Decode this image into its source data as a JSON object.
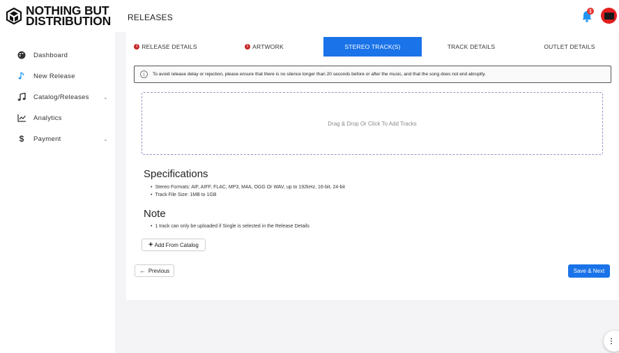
{
  "brand": {
    "line1": "NOTHING BUT",
    "line2": "DISTRIBUTION"
  },
  "header": {
    "title": "RELEASES",
    "notification_count": "1"
  },
  "sidebar": {
    "items": [
      {
        "label": "Dashboard",
        "icon": "palette-icon"
      },
      {
        "label": "New Release",
        "icon": "music-note-icon"
      },
      {
        "label": "Catalog/Releases",
        "icon": "music-notes-icon",
        "has_submenu": true
      },
      {
        "label": "Analytics",
        "icon": "chart-line-icon"
      },
      {
        "label": "Payment",
        "icon": "dollar-icon",
        "has_submenu": true
      }
    ]
  },
  "tabs": [
    {
      "label": "RELEASE DETAILS",
      "warning": true,
      "active": false
    },
    {
      "label": "ARTWORK",
      "warning": true,
      "active": false
    },
    {
      "label": "STEREO TRACK(S)",
      "warning": false,
      "active": true
    },
    {
      "label": "TRACK DETAILS",
      "warning": false,
      "active": false
    },
    {
      "label": "OUTLET DETAILS",
      "warning": false,
      "active": false
    }
  ],
  "notice": {
    "text": "To avoid release delay or rejection, please ensure that there is no silence longer than 20 seconds before or after the music, and that the song does not end abruptly."
  },
  "dropzone": {
    "text": "Drag & Drop Or Click To Add Tracks"
  },
  "specifications": {
    "title": "Specifications",
    "items": [
      "Stereo Formats: AIF, AIFF, FLAC, MP3, M4A, OGG Or WAV, up to 192kHz, 16-bit, 24-bit",
      "Track File Size: 1MB to 1GB"
    ]
  },
  "note": {
    "title": "Note",
    "items": [
      "1 track can only be uploaded if Single is selected in the Release Details"
    ]
  },
  "buttons": {
    "add_from_catalog": "Add From Catalog",
    "previous": "Previous",
    "save_next": "Save & Next"
  },
  "colors": {
    "accent": "#1a73e8",
    "warning": "#c62828",
    "dropzone_border": "#9c8fc4",
    "avatar": "#e21f1f"
  }
}
